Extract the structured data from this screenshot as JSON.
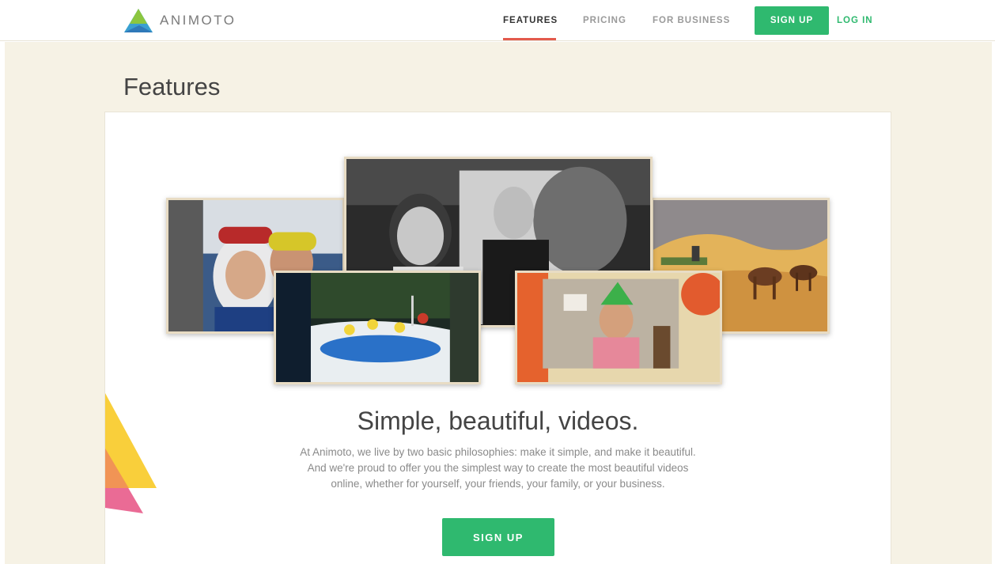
{
  "header": {
    "logo_text": "ANIMOTO",
    "nav": [
      {
        "label": "FEATURES",
        "active": true
      },
      {
        "label": "PRICING",
        "active": false
      },
      {
        "label": "FOR BUSINESS",
        "active": false
      }
    ],
    "signup_label": "SIGN UP",
    "login_label": "LOG IN"
  },
  "page": {
    "title": "Features"
  },
  "hero": {
    "headline": "Simple, beautiful, videos.",
    "description_lines": [
      "At Animoto, we live by two basic philosophies: make it simple, and make it beautiful.",
      "And we're proud to offer you the simplest way to create the most beautiful videos",
      "online, whether for yourself, your friends, your family, or your business."
    ],
    "signup_label": "SIGN UP"
  },
  "colors": {
    "brand_green": "#2fb96f",
    "active_underline": "#e35a4c",
    "page_background": "#f6f2e5"
  }
}
